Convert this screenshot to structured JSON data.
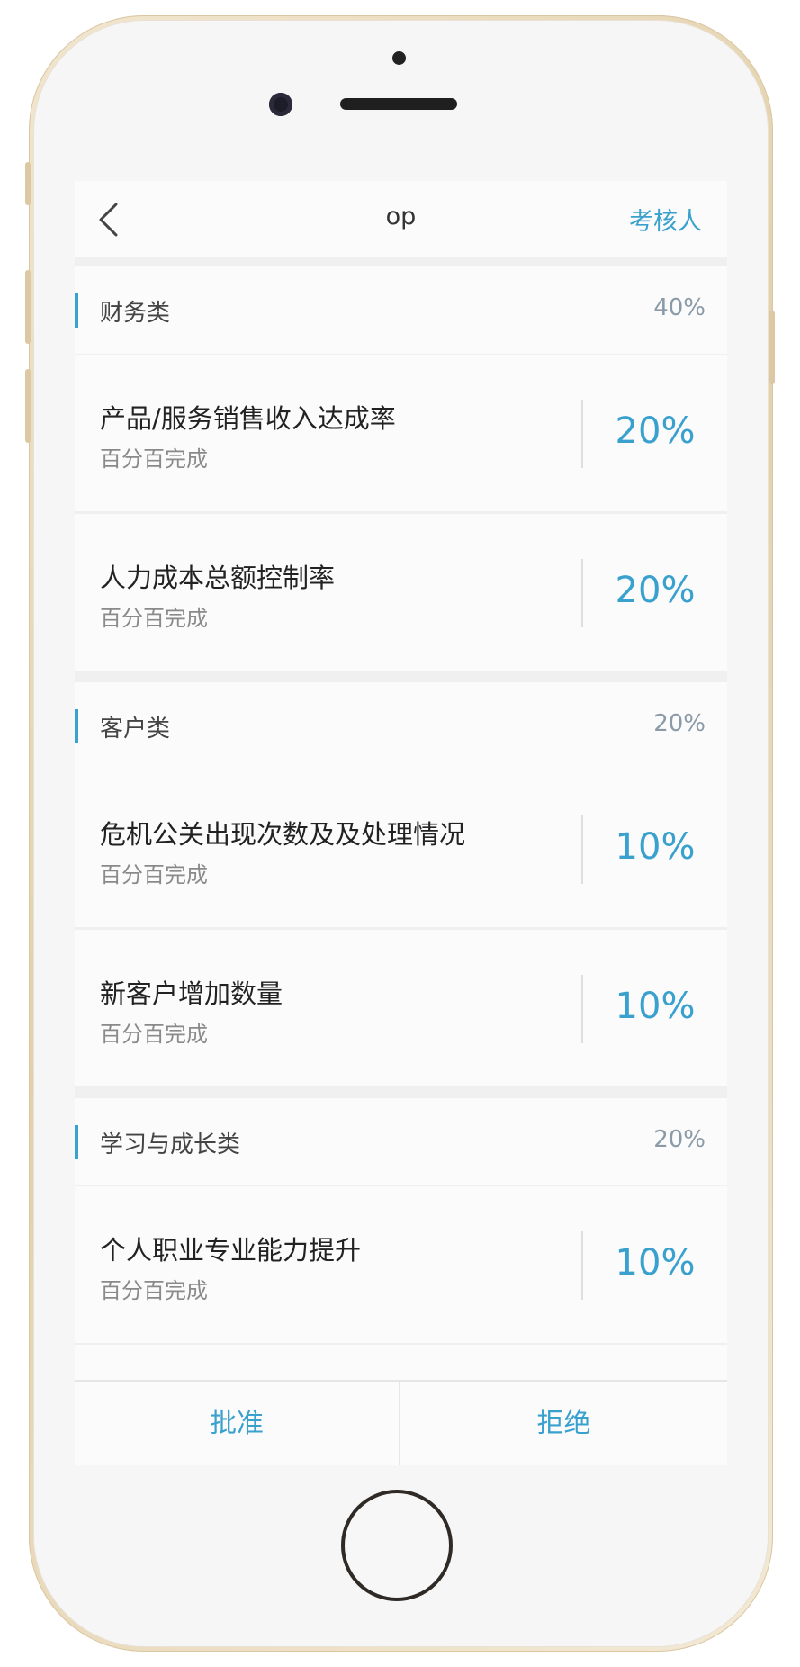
{
  "header": {
    "back_icon": "chevron-left-icon",
    "title": "op",
    "right_label": "考核人"
  },
  "sections": [
    {
      "name": "财务类",
      "percent": "40%",
      "items": [
        {
          "title": "产品/服务销售收入达成率",
          "subtitle": "百分百完成",
          "value": "20%"
        },
        {
          "title": "人力成本总额控制率",
          "subtitle": "百分百完成",
          "value": "20%"
        }
      ]
    },
    {
      "name": "客户类",
      "percent": "20%",
      "items": [
        {
          "title": "危机公关出现次数及及处理情况",
          "subtitle": "百分百完成",
          "value": "10%"
        },
        {
          "title": "新客户增加数量",
          "subtitle": "百分百完成",
          "value": "10%"
        }
      ]
    },
    {
      "name": "学习与成长类",
      "percent": "20%",
      "items": [
        {
          "title": "个人职业专业能力提升",
          "subtitle": "百分百完成",
          "value": "10%"
        }
      ]
    }
  ],
  "footer": {
    "approve_label": "批准",
    "reject_label": "拒绝"
  },
  "colors": {
    "accent": "#3aa1cf",
    "background": "#f0f0f0",
    "card": "#fbfbfb"
  }
}
